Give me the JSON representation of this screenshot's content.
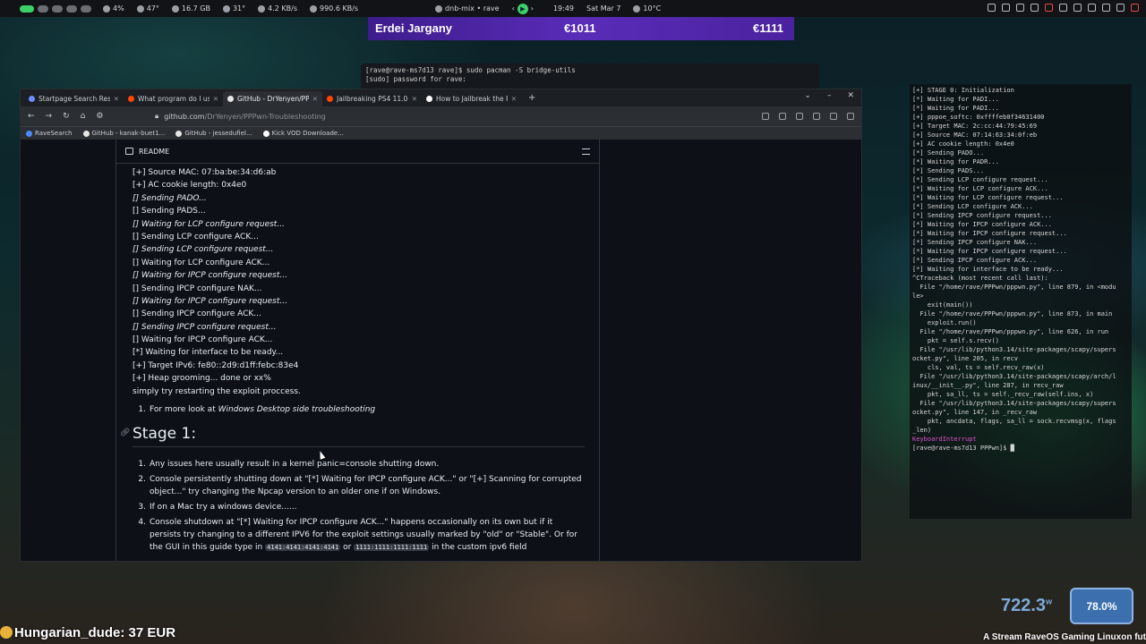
{
  "topbar": {
    "cpu": "4%",
    "cpu_temp": "47°",
    "ram": "16.7 GB",
    "gpu_temp": "31°",
    "net_down": "4.2 KB/s",
    "net_up": "990.6 KB/s",
    "media": "dnb-mix • rave",
    "time": "19:49",
    "date": "Sat Mar 7",
    "weather": "10°C"
  },
  "banner": {
    "name": "Erdei Jargany",
    "amount1": "€1011",
    "amount2": "€1111"
  },
  "term_back": {
    "line1": "[rave@rave-ms7d13 rave]$ sudo pacman -S bridge-utils",
    "line2": "[sudo] password for rave:"
  },
  "tabs": [
    {
      "label": "Startpage Search Resul",
      "color": "#6c8cff"
    },
    {
      "label": "What program do I use t",
      "color": "#ff4500"
    },
    {
      "label": "GitHub - DrYenyen/PPPw",
      "color": "#e6e6e6"
    },
    {
      "label": "Jailbreaking PS4 11.00 f",
      "color": "#ff4500"
    },
    {
      "label": "How to Jailbreak the PS",
      "color": "#ffffff"
    }
  ],
  "url": {
    "host": "github.com",
    "path": "/DrYenyen/PPPwn-Troubleshooting"
  },
  "bookmarks": [
    "RaveSearch",
    "GitHub - kanak-buet1...",
    "GitHub - jessedufiel...",
    "Kick VOD Downloade..."
  ],
  "readme": {
    "title": "README",
    "log_lines": [
      {
        "text": "[+] Source MAC: 07:ba:be:34:d6:ab",
        "italic": false
      },
      {
        "text": "[+] AC cookie length: 0x4e0",
        "italic": false
      },
      {
        "text": "[] Sending PADO...",
        "italic": true
      },
      {
        "text": "[] Sending PADS...",
        "italic": false
      },
      {
        "text": "[] Waiting for LCP configure request...",
        "italic": true
      },
      {
        "text": "[] Sending LCP configure ACK...",
        "italic": false
      },
      {
        "text": "[] Sending LCP configure request...",
        "italic": true
      },
      {
        "text": "[] Waiting for LCP configure ACK...",
        "italic": false
      },
      {
        "text": "[] Waiting for IPCP configure request...",
        "italic": true
      },
      {
        "text": "[] Sending IPCP configure NAK...",
        "italic": false
      },
      {
        "text": "[] Waiting for IPCP configure request...",
        "italic": true
      },
      {
        "text": "[] Sending IPCP configure ACK...",
        "italic": false
      },
      {
        "text": "[] Sending IPCP configure request...",
        "italic": true
      },
      {
        "text": "[] Waiting for IPCP configure ACK...",
        "italic": false
      },
      {
        "text": "[*] Waiting for interface to be ready...",
        "italic": false
      },
      {
        "text": "[+] Target IPv6: fe80::2d9:d1ff:febc:83e4",
        "italic": false
      },
      {
        "text": "[+] Heap grooming... done or xx%",
        "italic": false
      },
      {
        "text": "simply try restarting the exploit proccess.",
        "italic": false
      }
    ],
    "note_prefix": "For more look at ",
    "note_link": "Windows Desktop side troubleshooting",
    "stage_heading": "Stage 1:",
    "stage_items": [
      "Any issues here usually result in a kernel panic=console shutting down.",
      "Console persistently shutting down at \"[*] Waiting for IPCP configure ACK...\" or \"[+] Scanning for corrupted object...\" try changing the Npcap version to an older one if on Windows.",
      "If on a Mac try a windows device......",
      "Console shutdown at \"[*] Waiting for IPCP configure ACK...\" happens occasionally on its own but if it persists try changing to a different IPV6 for the exploit settings usually marked by \"old\" or \"Stable\". Or for the GUI in this guide type in"
    ],
    "stage_item4_code1": "4141:4141:4141:4141",
    "stage_item4_mid": " or ",
    "stage_item4_code2": "1111:1111:1111:1111",
    "stage_item4_end": " in the custom ipv6 field"
  },
  "terminal": {
    "lines": [
      "[+] STAGE 0: Initialization",
      "[*] Waiting for PADI...",
      "[*] Waiting for PADI...",
      "[+] pppoe_softc: 0xffffeb0f34631400",
      "[+] Target MAC: 2c:cc:44:79:45:69",
      "[+] Source MAC: 07:14:63:34:0f:eb",
      "[+] AC cookie length: 0x4e0",
      "[*] Sending PADO...",
      "[*] Waiting for PADR...",
      "[*] Sending PADS...",
      "[*] Sending LCP configure request...",
      "[*] Waiting for LCP configure ACK...",
      "[*] Waiting for LCP configure request...",
      "[*] Sending LCP configure ACK...",
      "[*] Sending IPCP configure request...",
      "[*] Waiting for IPCP configure ACK...",
      "[*] Waiting for IPCP configure request...",
      "[*] Sending IPCP configure NAK...",
      "[*] Waiting for IPCP configure request...",
      "[*] Sending IPCP configure ACK...",
      "[*] Waiting for interface to be ready...",
      "^CTraceback (most recent call last):",
      "  File \"/home/rave/PPPwn/pppwn.py\", line 879, in <modu",
      "le>",
      "    exit(main())",
      "",
      "  File \"/home/rave/PPPwn/pppwn.py\", line 873, in main",
      "    exploit.run()",
      "",
      "  File \"/home/rave/PPPwn/pppwn.py\", line 626, in run",
      "    pkt = self.s.recv()",
      "  File \"/usr/lib/python3.14/site-packages/scapy/supers",
      "ocket.py\", line 205, in recv",
      "    cls, val, ts = self.recv_raw(x)",
      "",
      "  File \"/usr/lib/python3.14/site-packages/scapy/arch/l",
      "inux/__init__.py\", line 287, in recv_raw",
      "    pkt, sa_ll, ts = self._recv_raw(self.ins, x)",
      "",
      "  File \"/usr/lib/python3.14/site-packages/scapy/supers",
      "ocket.py\", line 147, in _recv_raw",
      "    pkt, ancdata, flags, sa_ll = sock.recvmsg(x, flags",
      "_len)",
      "",
      "KeyboardInterrupt",
      "",
      "[rave@rave-ms7d13 PPPwn]$ █"
    ]
  },
  "donor": "Hungarian_dude: 37 EUR",
  "stream_caption": "A Stream RaveOS Gaming Linuxon fut",
  "power": {
    "value": "722.3",
    "unit": "w"
  },
  "percent": "78.0%"
}
